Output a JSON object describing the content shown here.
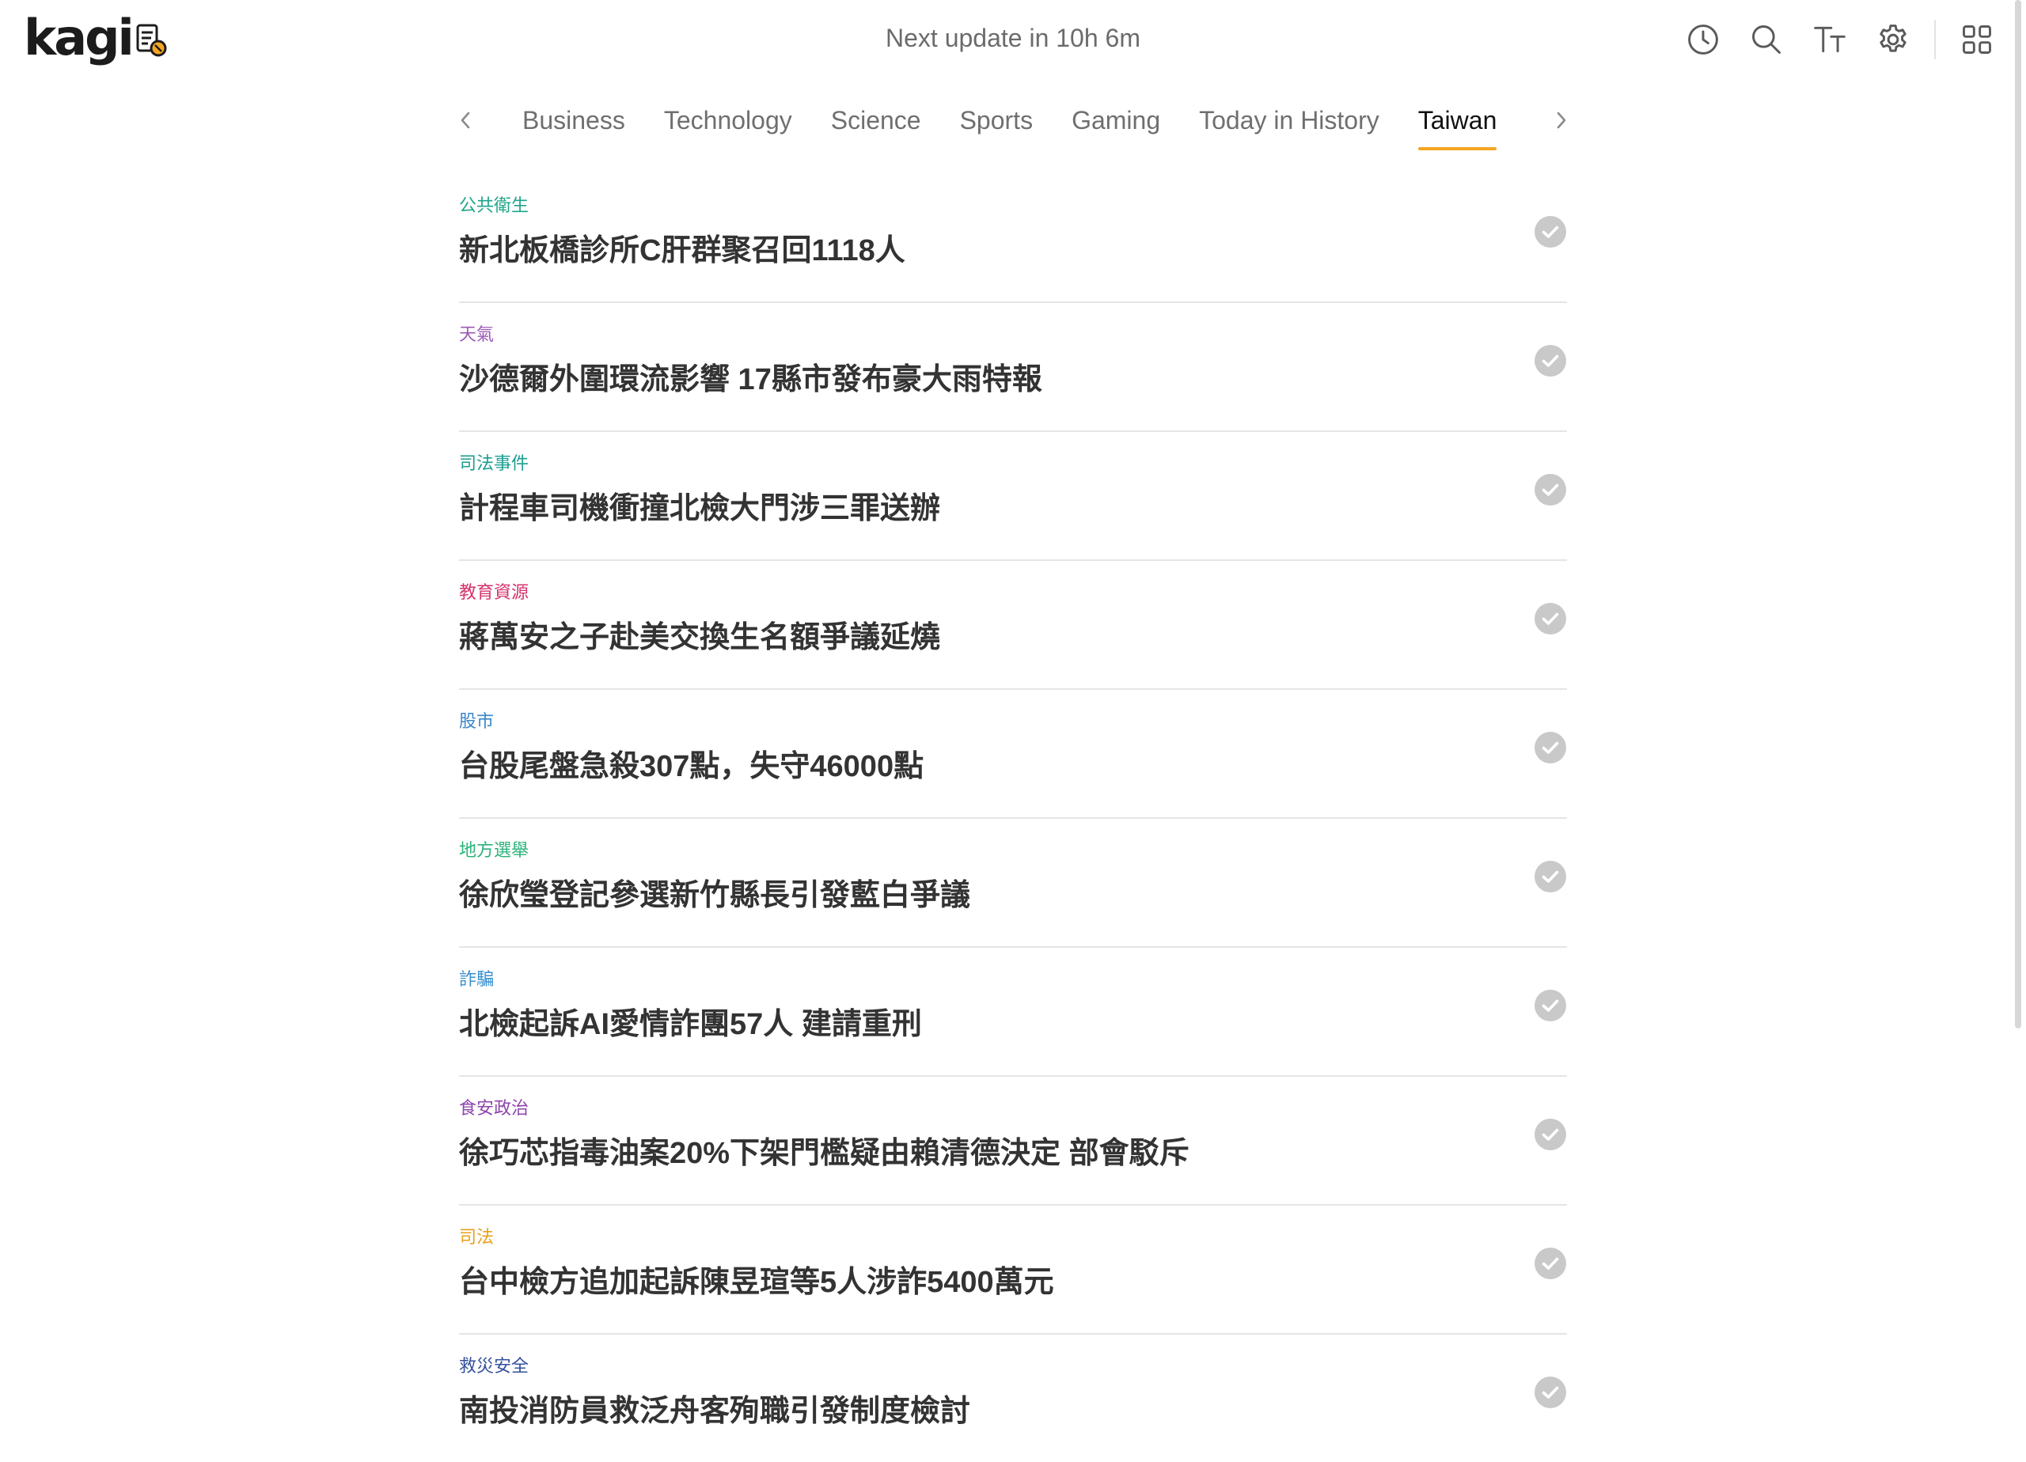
{
  "header": {
    "logo_text": "kagi",
    "update_text": "Next update in 10h 6m",
    "tools": [
      {
        "icon": "clock-icon"
      },
      {
        "icon": "search-icon"
      },
      {
        "icon": "text-size-icon"
      },
      {
        "icon": "gear-icon"
      },
      {
        "icon": "grid-icon"
      }
    ]
  },
  "tabs": [
    {
      "label": "Business"
    },
    {
      "label": "Technology"
    },
    {
      "label": "Science"
    },
    {
      "label": "Sports"
    },
    {
      "label": "Gaming"
    },
    {
      "label": "Today in History"
    },
    {
      "label": "Taiwan",
      "active": true
    }
  ],
  "colors": {
    "accent": "#f5a623",
    "check": "#c9c9c9"
  },
  "stories": [
    {
      "category": "公共衛生",
      "category_color": "#1fa58a",
      "title": "新北板橋診所C肝群聚召回1118人"
    },
    {
      "category": "天氣",
      "category_color": "#9b59b6",
      "title": "沙德爾外圍環流影響 17縣市發布豪大雨特報"
    },
    {
      "category": "司法事件",
      "category_color": "#1a9e8f",
      "title": "計程車司機衝撞北檢大門涉三罪送辦"
    },
    {
      "category": "教育資源",
      "category_color": "#d6336c",
      "title": "蔣萬安之子赴美交換生名額爭議延燒"
    },
    {
      "category": "股市",
      "category_color": "#3a86c8",
      "title": "台股尾盤急殺307點，失守46000點"
    },
    {
      "category": "地方選舉",
      "category_color": "#2cb37a",
      "title": "徐欣瑩登記參選新竹縣長引發藍白爭議"
    },
    {
      "category": "詐騙",
      "category_color": "#3a8fd0",
      "title": "北檢起訴AI愛情詐團57人 建請重刑"
    },
    {
      "category": "食安政治",
      "category_color": "#8e44ad",
      "title": "徐巧芯指毒油案20%下架門檻疑由賴清德決定 部會駁斥"
    },
    {
      "category": "司法",
      "category_color": "#e6a11a",
      "title": "台中檢方追加起訴陳昱瑄等5人涉詐5400萬元"
    },
    {
      "category": "救災安全",
      "category_color": "#34509e",
      "title": "南投消防員救泛舟客殉職引發制度檢討"
    }
  ]
}
